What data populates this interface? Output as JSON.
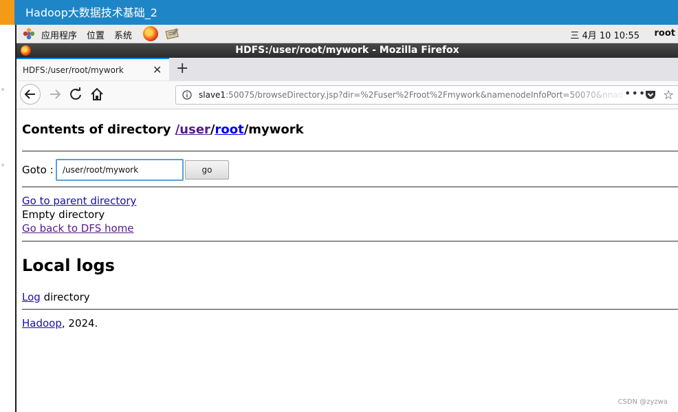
{
  "banner": {
    "title": "Hadoop大数据技术基础_2",
    "color": "#1e86c6",
    "accent": "#f49a19"
  },
  "panel": {
    "apps": "应用程序",
    "places": "位置",
    "system": "系统",
    "clock": "三 4月 10 10:55",
    "user": "root"
  },
  "window": {
    "title": "HDFS:/user/root/mywork - Mozilla Firefox"
  },
  "tab": {
    "title": "HDFS:/user/root/mywork",
    "close": "✕",
    "new": "+"
  },
  "urlbar": {
    "host": "slave1",
    "rest": ":50075/browseDirectory.jsp?dir=%2Fuser%2Froot%2Fmywork&namenodeInfoPort=50070&nnad",
    "more": "•••",
    "star": "☆"
  },
  "page": {
    "heading_prefix": "Contents of directory ",
    "heading_user": "/user",
    "heading_sep": "/",
    "heading_root": "root",
    "heading_suffix": "/mywork",
    "goto_label": "Goto : ",
    "goto_value": "/user/root/mywork",
    "go_button": "go",
    "parent_link": "Go to parent directory",
    "empty_text": "Empty directory",
    "dfs_home_link": "Go back to DFS home",
    "local_logs_heading": "Local logs",
    "log_link": "Log",
    "log_suffix": " directory",
    "hadoop_link": "Hadoop",
    "footer_suffix": ", 2024."
  },
  "watermark": "CSDN @zyzwa",
  "colors": {
    "link": "#0000ee",
    "visited": "#551a8b",
    "focus": "#5b9fd6"
  }
}
